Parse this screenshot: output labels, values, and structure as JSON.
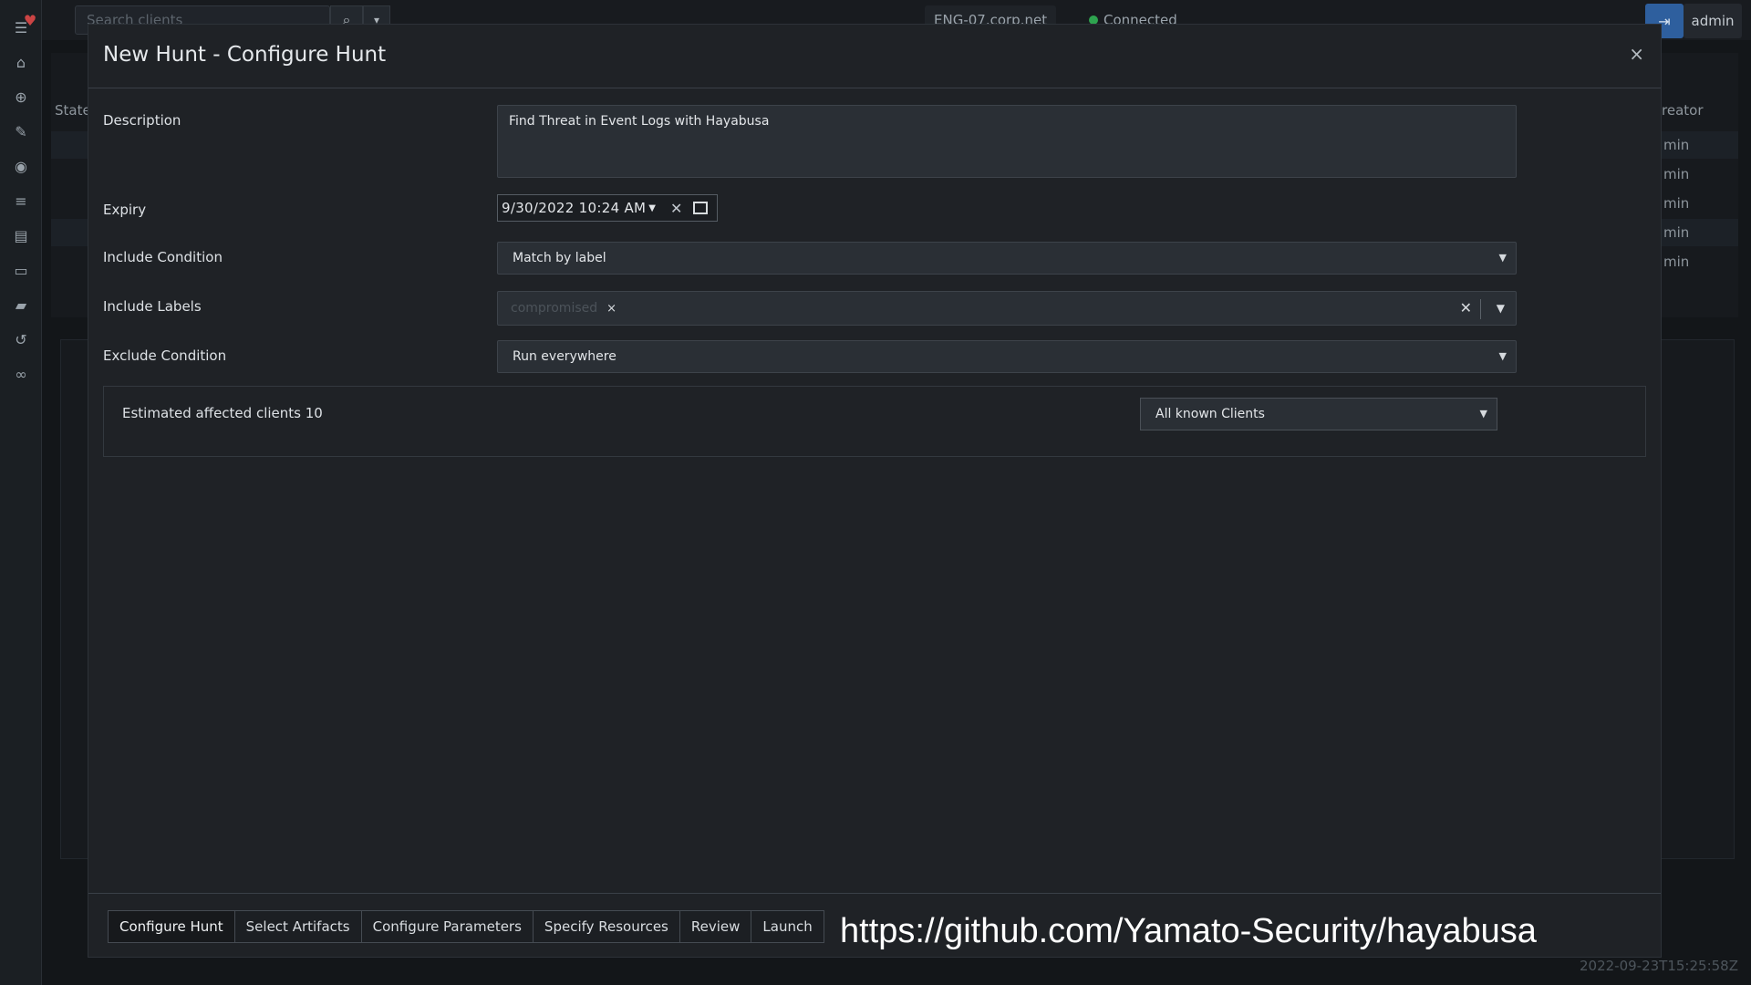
{
  "topbar": {
    "search_placeholder": "Search clients",
    "hostname": "ENG-07.corp.net",
    "status": "Connected",
    "user": "admin"
  },
  "background": {
    "state_header": "State",
    "creator_header": "reator",
    "creator_rows": [
      "min",
      "min",
      "min",
      "min",
      "min"
    ],
    "timestamp": "2022-09-23T15:25:58Z"
  },
  "modal": {
    "title": "New Hunt - Configure Hunt",
    "close": "×",
    "description_label": "Description",
    "description_value": "Find Threat in Event Logs with Hayabusa",
    "expiry_label": "Expiry",
    "expiry_value": "9/30/2022 10:24 AM",
    "include_condition_label": "Include Condition",
    "include_condition_value": "Match by label",
    "include_labels_label": "Include Labels",
    "include_labels_tag": "compromised",
    "exclude_condition_label": "Exclude Condition",
    "exclude_condition_value": "Run everywhere",
    "estimated_text": "Estimated affected clients 10",
    "clients_scope_value": "All known Clients"
  },
  "footer": {
    "steps": [
      "Configure Hunt",
      "Select Artifacts",
      "Configure Parameters",
      "Specify Resources",
      "Review",
      "Launch"
    ],
    "url": "https://github.com/Yamato-Security/hayabusa"
  }
}
